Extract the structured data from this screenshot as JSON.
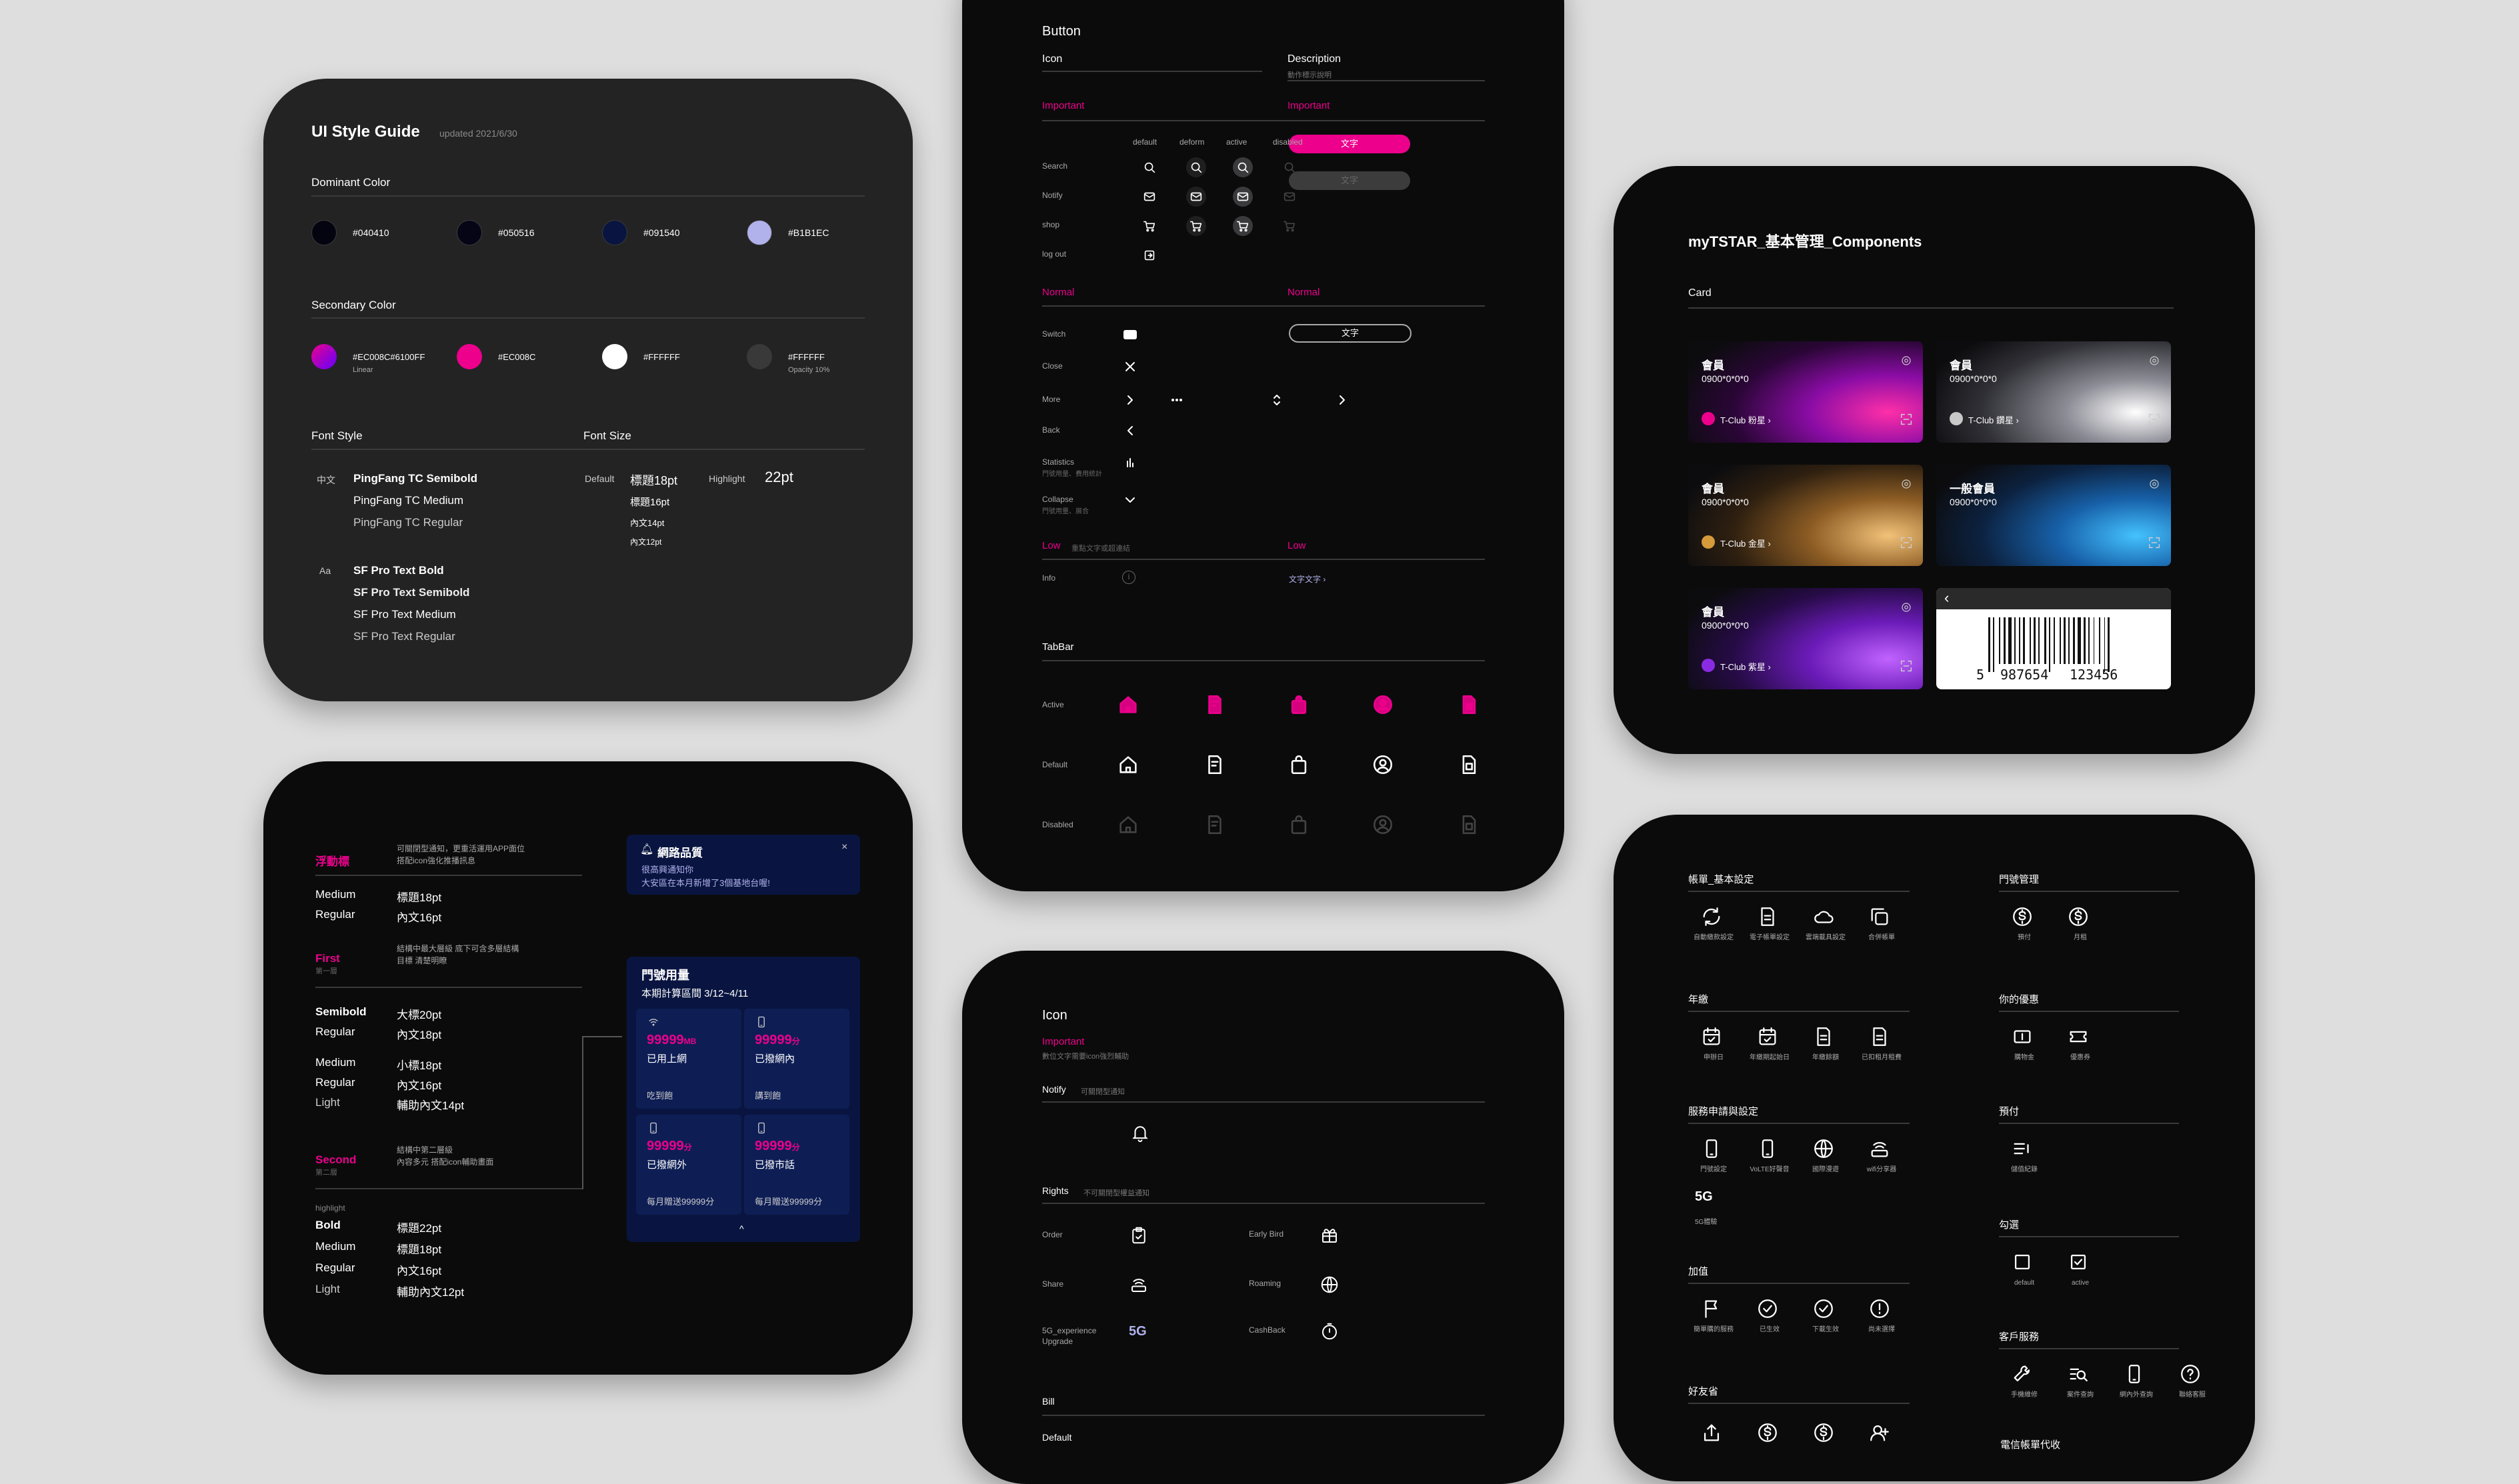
{
  "style_guide": {
    "title": "UI Style Guide",
    "updated": "updated 2021/6/30",
    "dominant_label": "Dominant Color",
    "dominant": [
      {
        "hex": "#040410",
        "label": "#040410"
      },
      {
        "hex": "#050516",
        "label": "#050516"
      },
      {
        "hex": "#091540",
        "label": "#091540"
      },
      {
        "hex": "#B1B1EC",
        "label": "#B1B1EC"
      }
    ],
    "secondary_label": "Secondary Color",
    "secondary": [
      {
        "label": "#EC008C#6100FF",
        "sub": "Linear"
      },
      {
        "label": "#EC008C",
        "sub": ""
      },
      {
        "label": "#FFFFFF",
        "sub": ""
      },
      {
        "label": "#FFFFFF",
        "sub": "Opacity 10%"
      }
    ],
    "font_style_label": "Font Style",
    "font_size_label": "Font Size",
    "zh_tag": "中文",
    "zh_fonts": [
      "PingFang TC Semibold",
      "PingFang TC Medium",
      "PingFang TC Regular"
    ],
    "en_tag": "Aa",
    "en_fonts": [
      "SF Pro Text Bold",
      "SF Pro Text Semibold",
      "SF Pro Text Medium",
      "SF Pro Text Regular"
    ],
    "default_label": "Default",
    "sizes": [
      "標題18pt",
      "標題16pt",
      "內文14pt",
      "內文12pt"
    ],
    "highlight_label": "Highlight",
    "highlight_size": "22pt"
  },
  "button_sheet": {
    "title": "Button",
    "icon_label": "Icon",
    "description_label": "Description",
    "description_sub": "動作標示說明",
    "important": "Important",
    "important2": "Important",
    "states": [
      "default",
      "deform",
      "active",
      "disabled"
    ],
    "rows": [
      "Search",
      "Notify",
      "shop",
      "log out"
    ],
    "btn_text": "文字",
    "btn_text_disabled": "文字",
    "normal": "Normal",
    "normal2": "Normal",
    "normal_rows": [
      "Switch",
      "Close",
      "More",
      "Back",
      "Statistics",
      "Collapse"
    ],
    "statistics_sub": "門號用量、費用統計",
    "collapse_sub": "門號用量、展合",
    "outline_text": "文字",
    "low": "Low",
    "low_sub": "重點文字或超連結",
    "low2": "Low",
    "info": "Info",
    "low_link": "文字文字 ›",
    "tabbar": "TabBar",
    "tab_rows": [
      "Active",
      "Default",
      "Disabled"
    ]
  },
  "components": {
    "title": "myTSTAR_基本管理_Components",
    "card_label": "Card",
    "cards": [
      {
        "name": "會員",
        "number": "0900*0*0*0",
        "tier": "T-Club 粉星 ›",
        "color": "#ec008c"
      },
      {
        "name": "會員",
        "number": "0900*0*0*0",
        "tier": "T-Club 鑽星 ›",
        "color": "#c8c8c8"
      },
      {
        "name": "會員",
        "number": "0900*0*0*0",
        "tier": "T-Club 金星 ›",
        "color": "#d59a3a"
      },
      {
        "name": "一般會員",
        "number": "0900*0*0*0",
        "tier": "",
        "color": "#1e8fd6"
      },
      {
        "name": "會員",
        "number": "0900*0*0*0",
        "tier": "T-Club 紫星 ›",
        "color": "#8a2be2"
      }
    ],
    "barcode_first": "5",
    "barcode_left": "987654",
    "barcode_right": "123456",
    "back_glyph": "‹"
  },
  "notifications": {
    "rows": [
      {
        "tag": "浮動標",
        "desc": "可關閉型通知，更重活運用APP面位",
        "desc2": "搭配icon強化推播訊息"
      },
      {
        "tag": "First",
        "tag_sub": "第一層",
        "desc": "結構中最大層級 底下可含多層結構",
        "desc2": "目標 清楚明瞭"
      },
      {
        "tag": "Second",
        "tag_sub": "第二層",
        "desc": "結構中第二層級",
        "desc2": "內容多元 搭配icon輔助畫面"
      }
    ],
    "weights_a": [
      [
        "Medium",
        "標題18pt"
      ],
      [
        "Regular",
        "內文16pt"
      ]
    ],
    "weights_b": [
      [
        "Semibold",
        "大標20pt"
      ],
      [
        "Regular",
        "內文18pt"
      ]
    ],
    "weights_c": [
      [
        "Medium",
        "小標18pt"
      ],
      [
        "Regular",
        "內文16pt"
      ],
      [
        "Light",
        "輔助內文14pt"
      ]
    ],
    "highlight_small": "highlight",
    "weights_d": [
      [
        "Bold",
        "標題22pt"
      ],
      [
        "Medium",
        "標題18pt"
      ],
      [
        "Regular",
        "內文16pt"
      ],
      [
        "Light",
        "輔助內文12pt"
      ]
    ],
    "toast_title": "網路品質",
    "toast_body1": "很高興通知你",
    "toast_body2": "大安區在本月新增了3個基地台喔!",
    "toast_close": "×",
    "usage_title": "門號用量",
    "usage_period": "本期計算區間 3/12~4/11",
    "tiles": [
      {
        "value": "99999",
        "unit": "MB",
        "label": "已用上網",
        "foot": "吃到飽"
      },
      {
        "value": "99999",
        "unit": "分",
        "label": "已撥網內",
        "foot": "講到飽"
      },
      {
        "value": "99999",
        "unit": "分",
        "label": "已撥網外",
        "foot": "每月贈送99999分"
      },
      {
        "value": "99999",
        "unit": "分",
        "label": "已撥市話",
        "foot": "每月贈送99999分"
      }
    ],
    "caret": "^"
  },
  "icon_sheet": {
    "title": "Icon",
    "important": "Important",
    "important_sub": "數位文字需要icon強烈輔助",
    "notify": "Notify",
    "notify_sub": "可關閉型通知",
    "rights": "Rights",
    "rights_sub": "不可關閉型權益通知",
    "items_left": [
      "Order",
      "Share",
      "5G_experience Upgrade"
    ],
    "items_right": [
      "Early Bird",
      "Roaming",
      "CashBack"
    ],
    "fiveg": "5G",
    "bill": "Bill",
    "default": "Default"
  },
  "menu_sheet": {
    "sec1": "帳單_基本設定",
    "sec1_items": [
      "自動繳款設定",
      "電子帳單設定",
      "雲端載具設定",
      "合併帳單"
    ],
    "sec2": "門號管理",
    "sec2_items": [
      "預付",
      "月租"
    ],
    "sec3": "年繳",
    "sec3_items": [
      "申辦日",
      "年繳期起始日",
      "年繳餘額",
      "已扣租月租費"
    ],
    "sec4": "你的優惠",
    "sec4_items": [
      "購物金",
      "優惠券"
    ],
    "sec5": "服務申請與設定",
    "sec5_items": [
      "門號設定",
      "VoLTE好聲音",
      "國際漫遊",
      "wifi分享器"
    ],
    "sec5_extra": "5G",
    "sec5_extra_label": "5G體驗",
    "sec6": "預付",
    "sec6_items": [
      "儲值紀錄"
    ],
    "sec7": "加值",
    "sec7_items": [
      "簡單購的服務",
      "已生效",
      "下載生效",
      "尚未選擇"
    ],
    "sec8": "勾選",
    "sec8_items": [
      "default",
      "active"
    ],
    "sec9": "客戶服務",
    "sec9_items": [
      "手機維修",
      "案件查詢",
      "網內外查詢",
      "聯絡客服"
    ],
    "sec10": "好友省",
    "sec11": "電信帳單代收"
  }
}
